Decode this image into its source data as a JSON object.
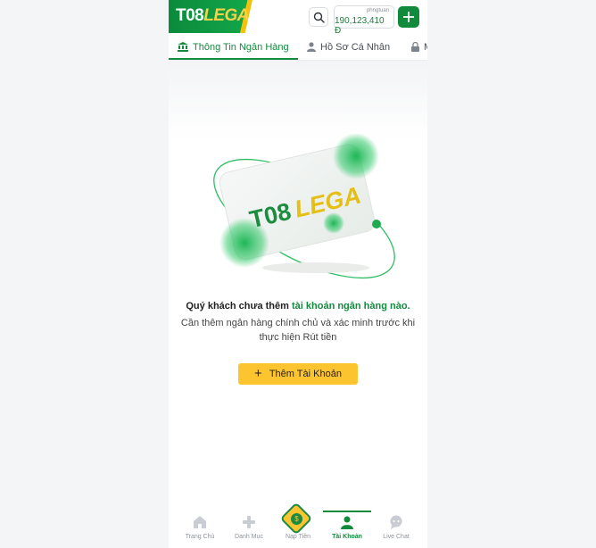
{
  "header": {
    "logo_part1": "T08",
    "logo_part2": "LEGA",
    "username": "phngtuan",
    "balance": "190,123,410 Đ"
  },
  "tabs": [
    {
      "label": "Thông Tin Ngân Hàng",
      "active": true
    },
    {
      "label": "Hồ Sơ Cá Nhân",
      "active": false
    },
    {
      "label": "M",
      "active": false
    }
  ],
  "illustration": {
    "card_logo_part1": "T08",
    "card_logo_part2": "LEGA"
  },
  "empty_state": {
    "title_prefix": "Quý khách chưa thêm ",
    "title_highlight": "tài khoản ngân hàng nào.",
    "description": "Cần thêm ngân hàng chính chủ và xác minh trước khi thực hiện Rút tiền",
    "add_button": "Thêm Tài Khoản"
  },
  "bottom_nav": [
    {
      "label": "Trang Chủ",
      "icon": "home-icon"
    },
    {
      "label": "Danh Mục",
      "icon": "gamepad-icon"
    },
    {
      "label": "Nạp Tiền",
      "icon": "deposit-icon",
      "coin_symbol": "$"
    },
    {
      "label": "Tài Khoản",
      "icon": "user-icon",
      "active": true
    },
    {
      "label": "Live Chat",
      "icon": "chat-icon"
    }
  ],
  "colors": {
    "brand_green": "#138a3d",
    "accent_yellow": "#fcc52f"
  }
}
